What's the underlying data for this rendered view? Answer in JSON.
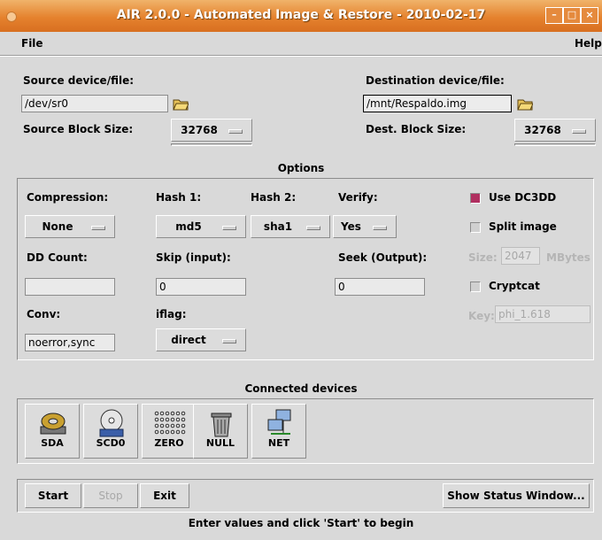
{
  "window": {
    "title": "AIR 2.0.0 - Automated Image & Restore - 2010-02-17",
    "controls": [
      "minimize",
      "maximize",
      "close"
    ]
  },
  "menubar": {
    "file": "File",
    "help": "Help"
  },
  "source": {
    "label": "Source device/file:",
    "value": "/dev/sr0",
    "block_size_label": "Source Block Size:",
    "block_size": "32768"
  },
  "destination": {
    "label": "Destination device/file:",
    "value": "/mnt/Respaldo.img",
    "block_size_label": "Dest. Block Size:",
    "block_size": "32768"
  },
  "options": {
    "title": "Options",
    "compression_label": "Compression:",
    "compression": "None",
    "hash1_label": "Hash 1:",
    "hash1": "md5",
    "hash2_label": "Hash 2:",
    "hash2": "sha1",
    "verify_label": "Verify:",
    "verify": "Yes",
    "use_dc3dd_label": "Use DC3DD",
    "use_dc3dd": true,
    "split_image_label": "Split image",
    "split_image": false,
    "ddcount_label": "DD Count:",
    "ddcount": "",
    "skip_label": "Skip (input):",
    "skip": "0",
    "seek_label": "Seek (Output):",
    "seek": "0",
    "size_label": "Size:",
    "size": "2047",
    "size_unit": "MBytes",
    "cryptcat_label": "Cryptcat",
    "cryptcat": false,
    "key_label": "Key:",
    "key": "phi_1.618",
    "conv_label": "Conv:",
    "conv": "noerror,sync",
    "iflag_label": "iflag:",
    "iflag": "direct"
  },
  "devices": {
    "title": "Connected devices",
    "items": [
      {
        "label": "SDA",
        "icon": "harddisk-icon"
      },
      {
        "label": "SCD0",
        "icon": "cdrom-icon"
      },
      {
        "label": "ZERO",
        "icon": "zero-icon"
      },
      {
        "label": "NULL",
        "icon": "trash-icon"
      },
      {
        "label": "NET",
        "icon": "network-icon"
      }
    ]
  },
  "buttons": {
    "start": "Start",
    "stop": "Stop",
    "exit": "Exit",
    "status": "Show Status Window..."
  },
  "status_text": "Enter values and click 'Start' to begin",
  "colors": {
    "titlebar": "#e5822e",
    "checkbox_on": "#b03060"
  }
}
